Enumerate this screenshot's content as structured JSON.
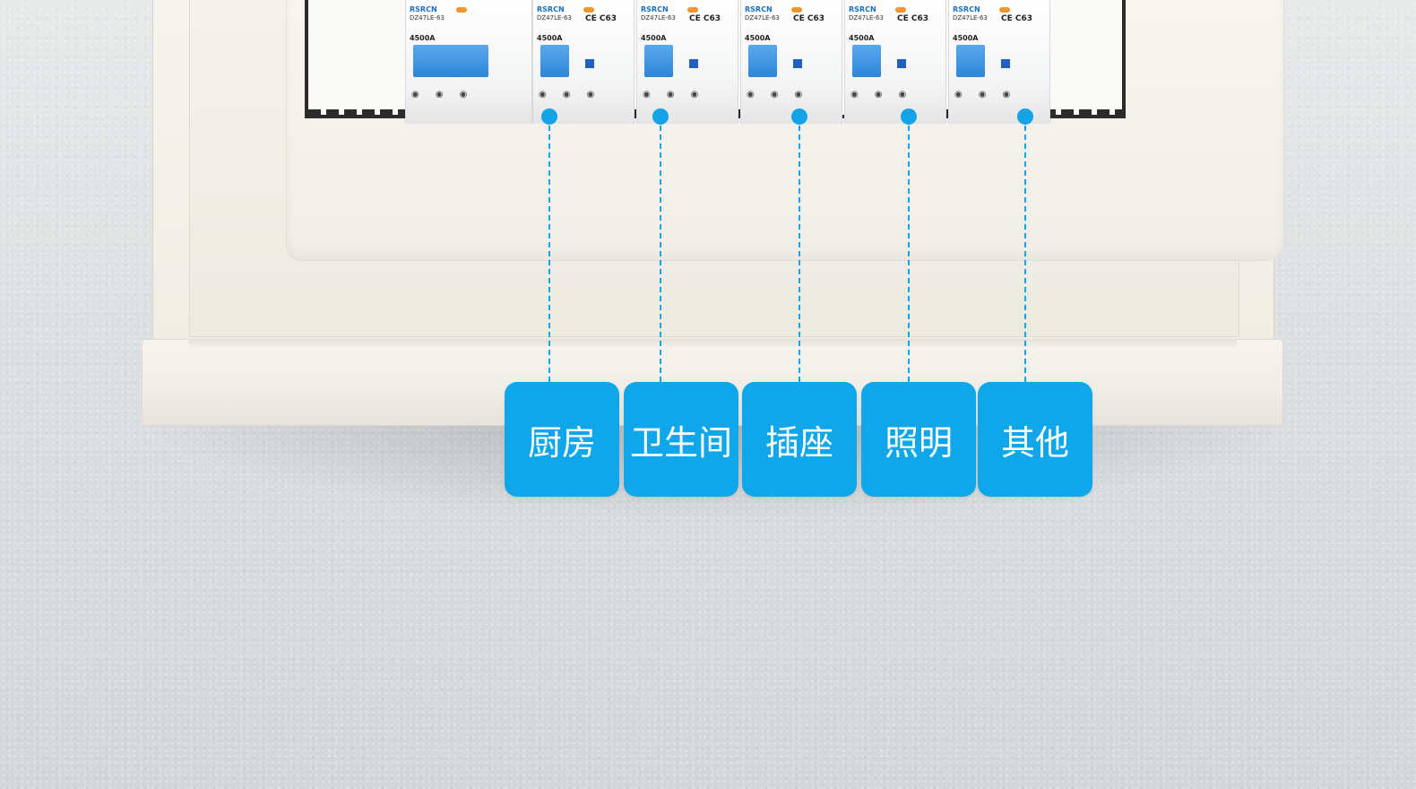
{
  "breaker_labels": {
    "brand": "RSRCN",
    "model": "DZ47LE-63",
    "rating": "4500A",
    "ce": "CE C63"
  },
  "circuits": [
    {
      "label": "厨房"
    },
    {
      "label": "卫生间"
    },
    {
      "label": "插座"
    },
    {
      "label": "照明"
    },
    {
      "label": "其他"
    }
  ],
  "colors": {
    "accent": "#10a7ea",
    "handle": "#2e86d9",
    "cabinet": "#f4f2ea"
  }
}
